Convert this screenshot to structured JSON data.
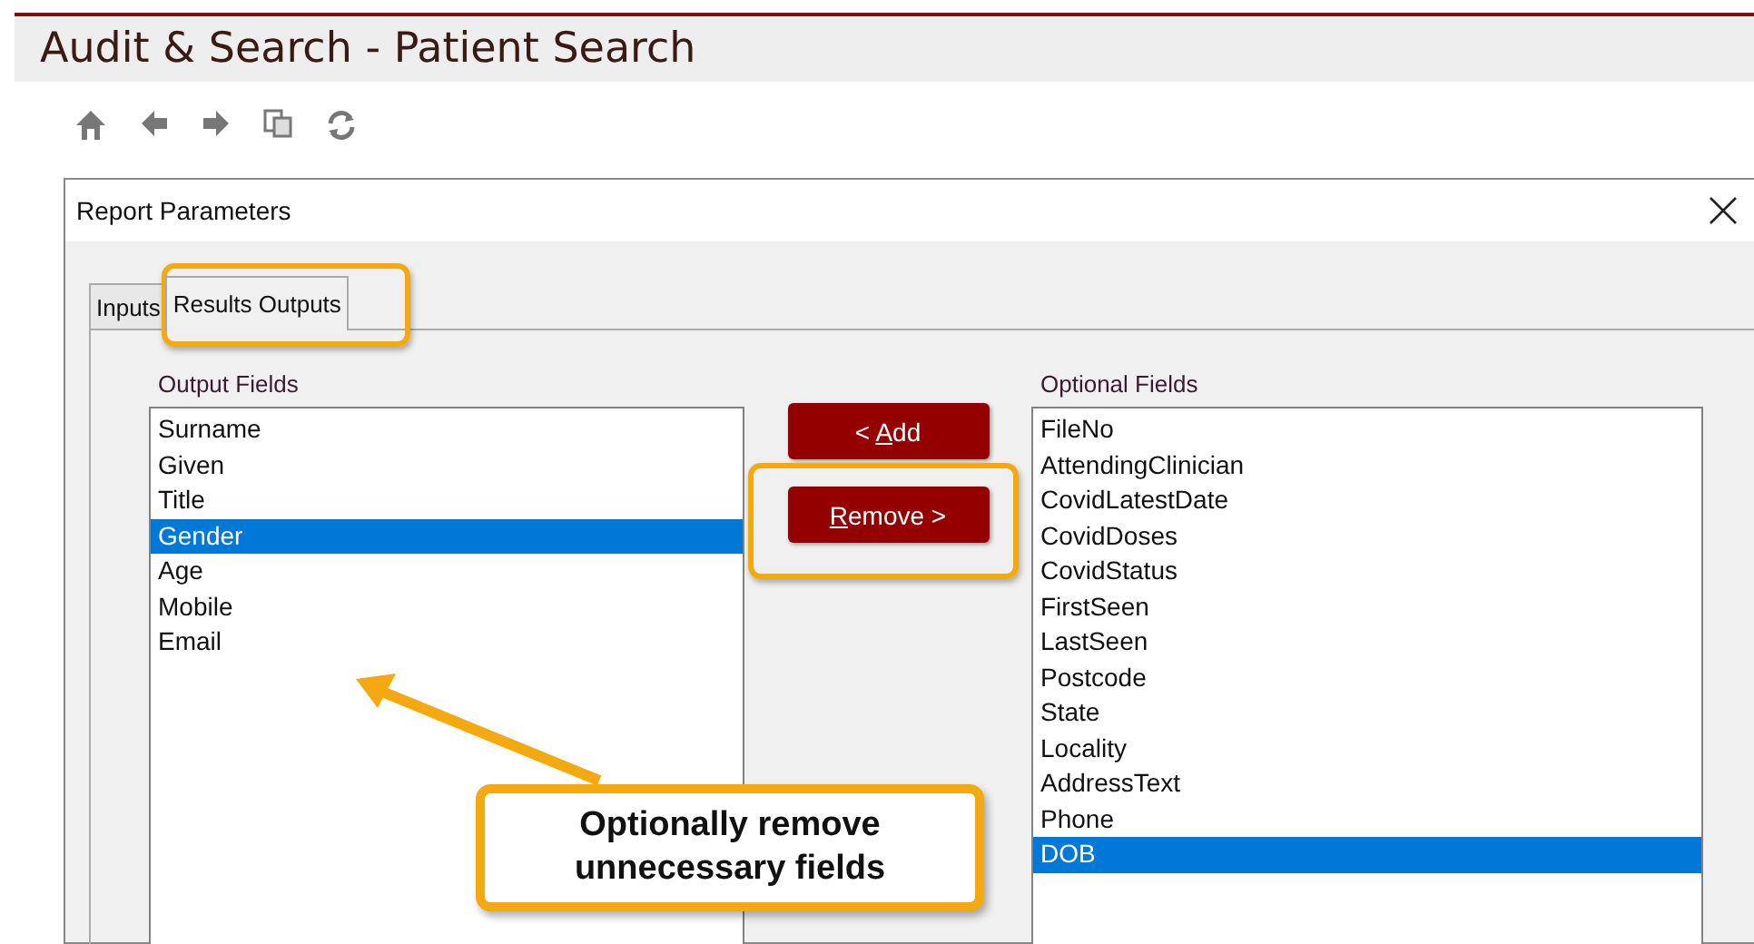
{
  "page_title": "Audit & Search - Patient Search",
  "toolbar": [
    {
      "kind": "home"
    },
    {
      "kind": "back"
    },
    {
      "kind": "forward"
    },
    {
      "kind": "copy"
    },
    {
      "kind": "refresh"
    }
  ],
  "dialog": {
    "title": "Report Parameters",
    "tabs": [
      {
        "label": "Inputs",
        "selected": false
      },
      {
        "label": "Results Outputs",
        "selected": true
      }
    ],
    "output_fields": {
      "label": "Output Fields",
      "items": [
        {
          "text": "Surname",
          "selected": false
        },
        {
          "text": "Given",
          "selected": false
        },
        {
          "text": "Title",
          "selected": false
        },
        {
          "text": "Gender",
          "selected": true
        },
        {
          "text": "Age",
          "selected": false
        },
        {
          "text": "Mobile",
          "selected": false
        },
        {
          "text": "Email",
          "selected": false
        }
      ]
    },
    "buttons": [
      {
        "prefix": "< ",
        "key": "A",
        "suffix": "dd"
      },
      {
        "key": "R",
        "suffix": "emove >"
      }
    ],
    "optional_fields": {
      "label": "Optional Fields",
      "items": [
        {
          "text": "FileNo",
          "selected": false
        },
        {
          "text": "AttendingClinician",
          "selected": false
        },
        {
          "text": "CovidLatestDate",
          "selected": false
        },
        {
          "text": "CovidDoses",
          "selected": false
        },
        {
          "text": "CovidStatus",
          "selected": false
        },
        {
          "text": "FirstSeen",
          "selected": false
        },
        {
          "text": "LastSeen",
          "selected": false
        },
        {
          "text": "Postcode",
          "selected": false
        },
        {
          "text": "State",
          "selected": false
        },
        {
          "text": "Locality",
          "selected": false
        },
        {
          "text": "AddressText",
          "selected": false
        },
        {
          "text": "Phone",
          "selected": false
        },
        {
          "text": "DOB",
          "selected": true
        }
      ]
    }
  },
  "callout": {
    "text": "Optionally remove unnecessary fields"
  }
}
